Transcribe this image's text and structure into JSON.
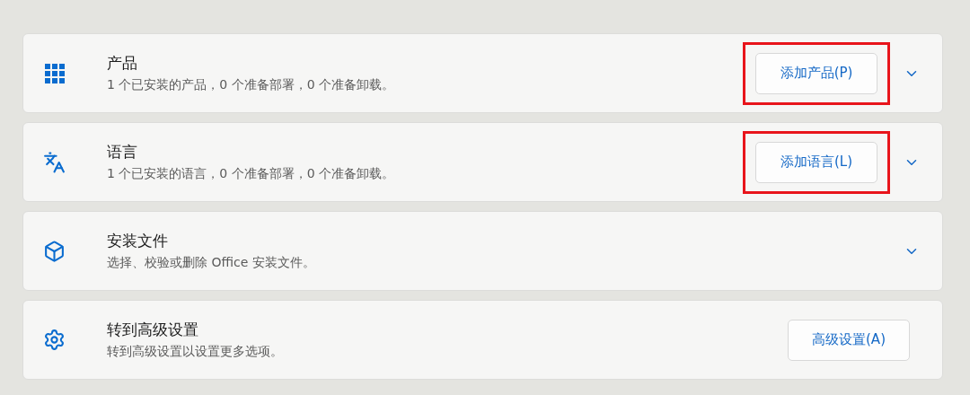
{
  "sections": [
    {
      "kind": "products",
      "title": "产品",
      "description": "1 个已安装的产品，0 个准备部署，0 个准备卸载。",
      "button": {
        "label": "添加产品(P)",
        "highlighted": true
      },
      "expandable": true
    },
    {
      "kind": "languages",
      "title": "语言",
      "description": "1 个已安装的语言，0 个准备部署，0 个准备卸载。",
      "button": {
        "label": "添加语言(L)",
        "highlighted": true
      },
      "expandable": true
    },
    {
      "kind": "files",
      "title": "安装文件",
      "description": "选择、校验或删除 Office 安装文件。",
      "expandable": true
    },
    {
      "kind": "advanced",
      "title": "转到高级设置",
      "description": "转到高级设置以设置更多选项。",
      "button": {
        "label": "高级设置(A)",
        "highlighted": false
      },
      "expandable": false
    }
  ]
}
